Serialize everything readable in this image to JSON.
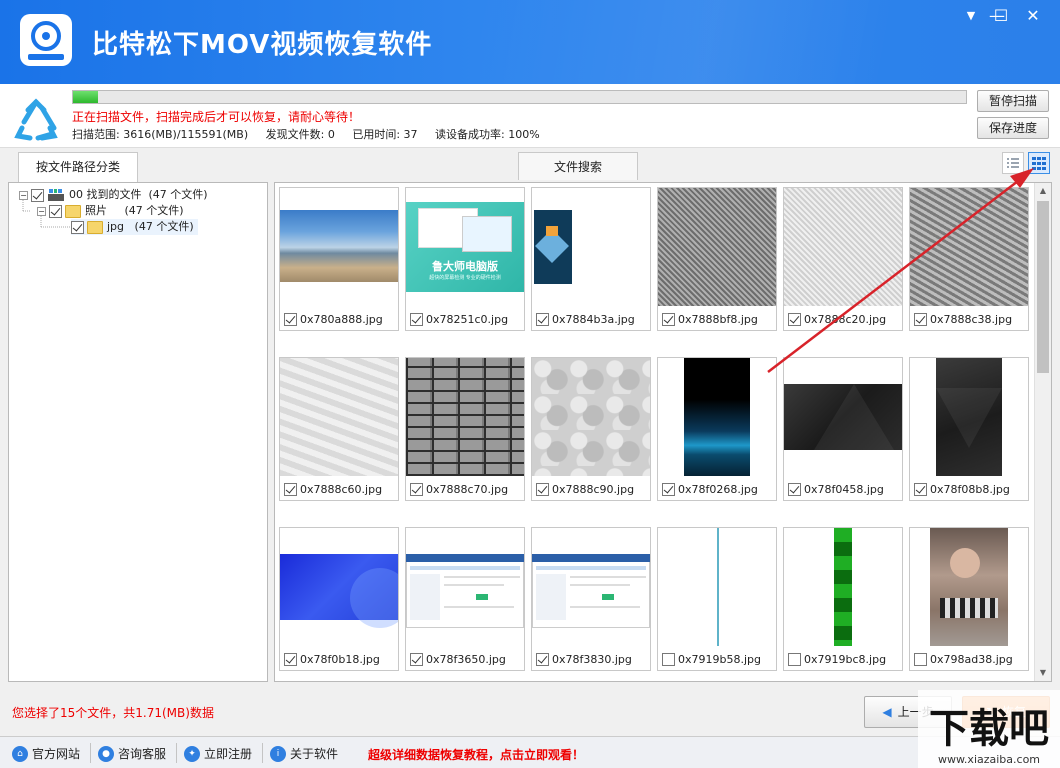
{
  "app": {
    "title": "比特松下MOV视频恢复软件",
    "window_controls": {
      "menu": "▼",
      "minimize": "—",
      "maximize": "☐",
      "close": "✕"
    }
  },
  "status": {
    "progress_fraction": 0.028,
    "message": "正在扫描文件，扫描完成后才可以恢复，请耐心等待！",
    "scan_range": "扫描范围: 3616(MB)/115591(MB)",
    "found_files": "发现文件数: 0",
    "elapsed": "已用时间: 37",
    "read_success": "读设备成功率: 100%",
    "pause_label": "暂停扫描",
    "save_label": "保存进度"
  },
  "tabs": {
    "by_path": "按文件路径分类",
    "search": "文件搜索"
  },
  "tree": [
    {
      "label": "00 找到的文件",
      "count": "(47 个文件)",
      "type": "drive",
      "checked": true,
      "expanded": true
    },
    {
      "label": "照片",
      "count": "(47 个文件)",
      "type": "folder",
      "checked": true,
      "expanded": true
    },
    {
      "label": "jpg",
      "count": "(47 个文件)",
      "type": "folder",
      "checked": true,
      "expanded": false
    }
  ],
  "files": [
    {
      "name": "0x780a888.jpg",
      "checked": true,
      "thumb": "sea"
    },
    {
      "name": "0x78251c0.jpg",
      "checked": true,
      "thumb": "ad"
    },
    {
      "name": "0x7884b3a.jpg",
      "checked": true,
      "thumb": "icon"
    },
    {
      "name": "0x7888bf8.jpg",
      "checked": true,
      "thumb": "noise-dark"
    },
    {
      "name": "0x7888c20.jpg",
      "checked": true,
      "thumb": "noise-light"
    },
    {
      "name": "0x7888c38.jpg",
      "checked": true,
      "thumb": "noise-mid"
    },
    {
      "name": "0x7888c60.jpg",
      "checked": true,
      "thumb": "paper"
    },
    {
      "name": "0x7888c70.jpg",
      "checked": true,
      "thumb": "brick"
    },
    {
      "name": "0x7888c90.jpg",
      "checked": true,
      "thumb": "stone"
    },
    {
      "name": "0x78f0268.jpg",
      "checked": true,
      "thumb": "mountain"
    },
    {
      "name": "0x78f0458.jpg",
      "checked": true,
      "thumb": "dark-poly"
    },
    {
      "name": "0x78f08b8.jpg",
      "checked": true,
      "thumb": "dark-poly-tall"
    },
    {
      "name": "0x78f0b18.jpg",
      "checked": true,
      "thumb": "blue"
    },
    {
      "name": "0x78f3650.jpg",
      "checked": true,
      "thumb": "screen"
    },
    {
      "name": "0x78f3830.jpg",
      "checked": true,
      "thumb": "screen"
    },
    {
      "name": "0x7919b58.jpg",
      "checked": false,
      "thumb": "line"
    },
    {
      "name": "0x7919bc8.jpg",
      "checked": false,
      "thumb": "green-strip"
    },
    {
      "name": "0x798ad38.jpg",
      "checked": false,
      "thumb": "photo"
    }
  ],
  "thumb_texts": {
    "ad_title": "鲁大师电脑版",
    "ad_sub": "超快的屏幕检测 专业的硬件检测"
  },
  "selection_info": "您选择了15个文件，共1.71(MB)数据",
  "nav": {
    "prev": "上一步",
    "recover": "恢复"
  },
  "footer": {
    "website": "官方网站",
    "support": "咨询客服",
    "register": "立即注册",
    "about": "关于软件",
    "promo": "超级详细数据恢复教程，点击立即观看！"
  },
  "watermark": {
    "text": "下载吧",
    "url": "www.xiazaiba.com"
  },
  "colors": {
    "accent": "#1a73e8",
    "warning": "#e00000",
    "progress": "#2db82d",
    "recover": "#f47a20"
  }
}
